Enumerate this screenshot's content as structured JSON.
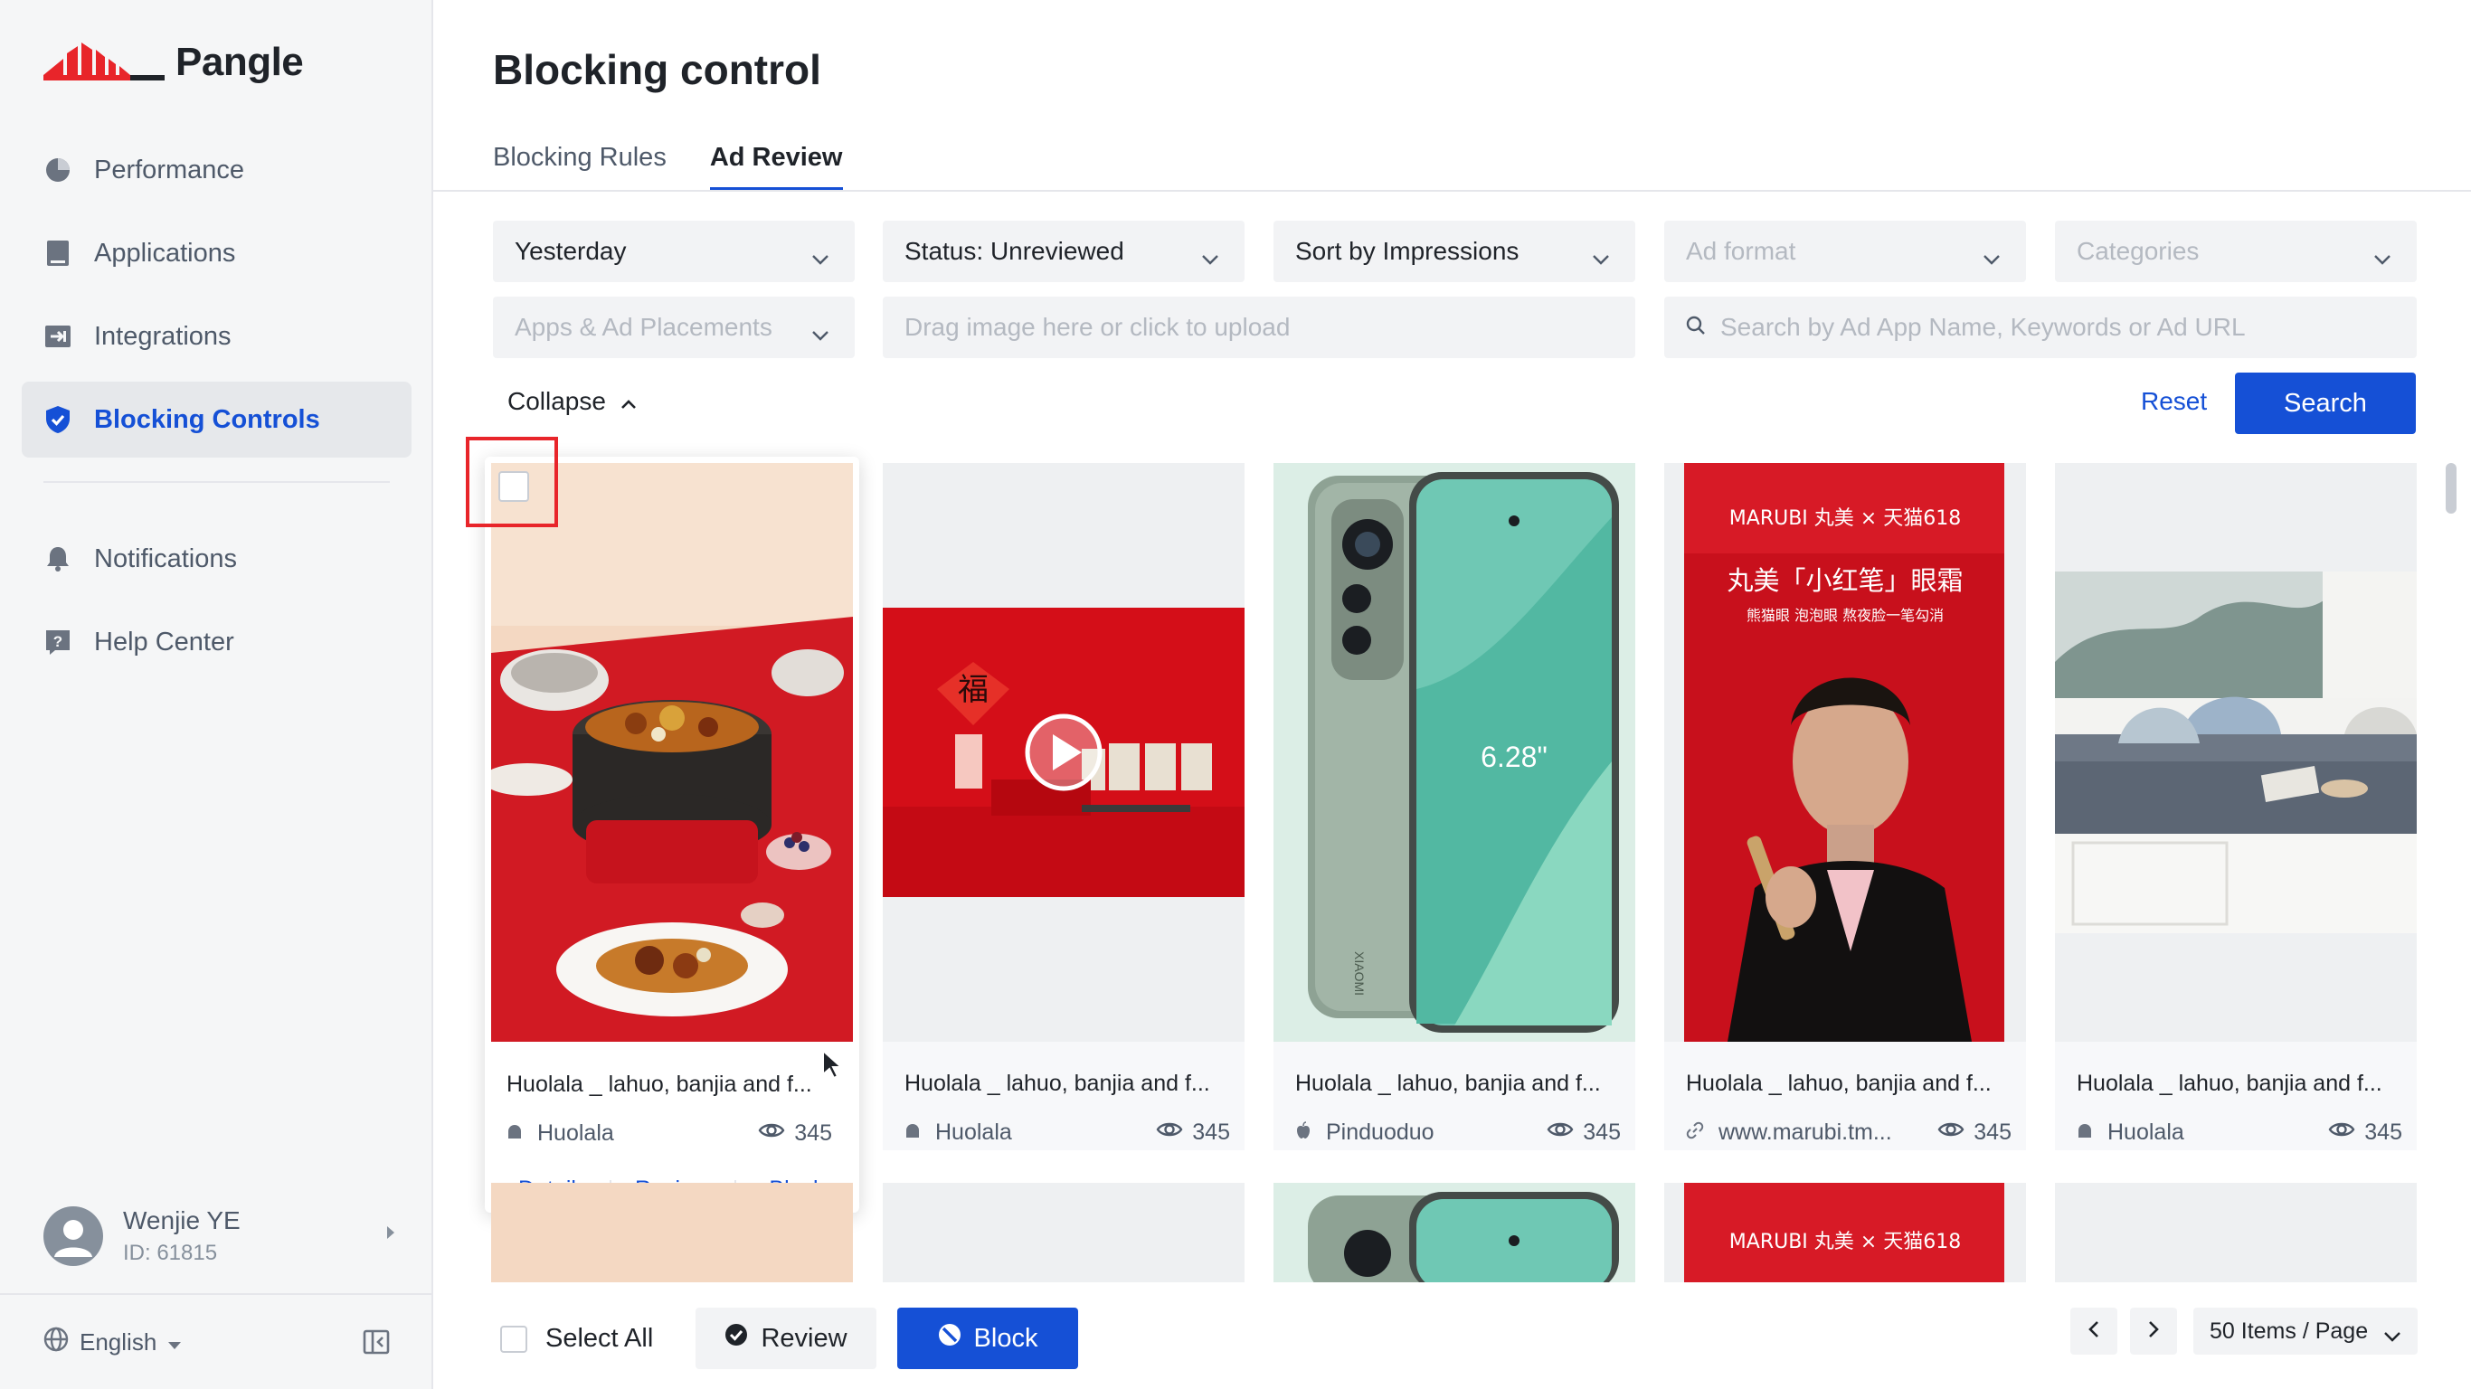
{
  "brand": {
    "name": "Pangle",
    "color": "#e8252a"
  },
  "sidebar": {
    "items": [
      {
        "label": "Performance",
        "icon": "pie-chart-icon"
      },
      {
        "label": "Applications",
        "icon": "tablet-icon"
      },
      {
        "label": "Integrations",
        "icon": "integration-icon"
      },
      {
        "label": "Blocking Controls",
        "icon": "shield-icon",
        "active": true
      },
      {
        "label": "Notifications",
        "icon": "bell-icon"
      },
      {
        "label": "Help Center",
        "icon": "help-icon"
      }
    ],
    "user": {
      "name": "Wenjie YE",
      "id": "ID: 61815"
    },
    "language": "English"
  },
  "page": {
    "title": "Blocking control",
    "tabs": [
      {
        "label": "Blocking Rules"
      },
      {
        "label": "Ad Review",
        "active": true
      }
    ]
  },
  "filters": {
    "date": "Yesterday",
    "status": "Status: Unreviewed",
    "sort": "Sort by Impressions",
    "ad_format": "Ad format",
    "categories": "Categories",
    "apps_placements": "Apps & Ad Placements",
    "upload": "Drag image here or click to upload",
    "search_placeholder": "Search by Ad App Name, Keywords or Ad URL"
  },
  "actions": {
    "collapse": "Collapse",
    "reset": "Reset",
    "search": "Search"
  },
  "cards": [
    {
      "title": "Huolala _ lahuo, banjia and f...",
      "app": "Huolala",
      "app_icon": "android-icon",
      "views": "345",
      "image": "hotpot-food-photo"
    },
    {
      "title": "Huolala _ lahuo, banjia and f...",
      "app": "Huolala",
      "app_icon": "android-icon",
      "views": "345",
      "image": "red-festival-video"
    },
    {
      "title": "Huolala _ lahuo, banjia and f...",
      "app": "Pinduoduo",
      "app_icon": "apple-icon",
      "views": "345",
      "image": "green-phone-photo",
      "phone_text": "6.28\"",
      "phone_brand": "XIAOMI"
    },
    {
      "title": "Huolala _ lahuo, banjia and f...",
      "app": "www.marubi.tm...",
      "app_icon": "link-icon",
      "views": "345",
      "image": "eye-cream-ad",
      "ad_brand": "MARUBI 丸美 × 天猫618",
      "ad_headline": "丸美「小红笔」眼霜",
      "ad_sub": "熊猫眼 泡泡眼 熬夜脸一笔勾消"
    },
    {
      "title": "Huolala _ lahuo, banjia and f...",
      "app": "Huolala",
      "app_icon": "android-icon",
      "views": "345",
      "image": "window-seat-photo"
    }
  ],
  "card_actions": {
    "detail": "Detail",
    "review": "Review",
    "block": "Block"
  },
  "row2_brand": "MARUBI 丸美 × 天猫618",
  "bottom": {
    "select_all": "Select All",
    "review": "Review",
    "block": "Block",
    "per_page": "50 Items / Page"
  },
  "colors": {
    "primary": "#1550d6",
    "highlight": "#e8252a",
    "sidebar_bg": "#f5f6f7"
  }
}
